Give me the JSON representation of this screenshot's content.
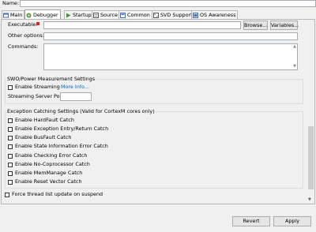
{
  "header": {
    "name_label": "Name:"
  },
  "tabs": [
    {
      "label": "Main"
    },
    {
      "label": "Debugger"
    },
    {
      "label": "Startup"
    },
    {
      "label": "Source"
    },
    {
      "label": "Common"
    },
    {
      "label": "SVD Support"
    },
    {
      "label": "OS Awareness"
    }
  ],
  "form": {
    "executable_label": "Executable:",
    "browse_label": "Browse...",
    "variables_label": "Variables...",
    "other_options_label": "Other options:",
    "commands_label": "Commands:"
  },
  "swo": {
    "title": "SWO/Power Measurement Settings",
    "enable_streaming_label": "Enable Streaming",
    "more_info_label": "More Info...",
    "port_label": "Streaming Server Port:"
  },
  "exceptions": {
    "title": "Exception Catching Settings (Valid for CortexM cores only)",
    "items": [
      "Enable HardFault Catch",
      "Enable Exception Entry/Return Catch",
      "Enable BusFault Catch",
      "Enable State Information Error Catch",
      "Enable Checking Error Catch",
      "Enable No-Coprocessor Catch",
      "Enable MemManage Catch",
      "Enable Reset Vector Catch"
    ]
  },
  "force_update_label": "Force thread list update on suspend",
  "footer": {
    "revert_label": "Revert",
    "apply_label": "Apply"
  },
  "colors": {
    "link": "#0066cc",
    "error_marker": "#d9281c"
  }
}
